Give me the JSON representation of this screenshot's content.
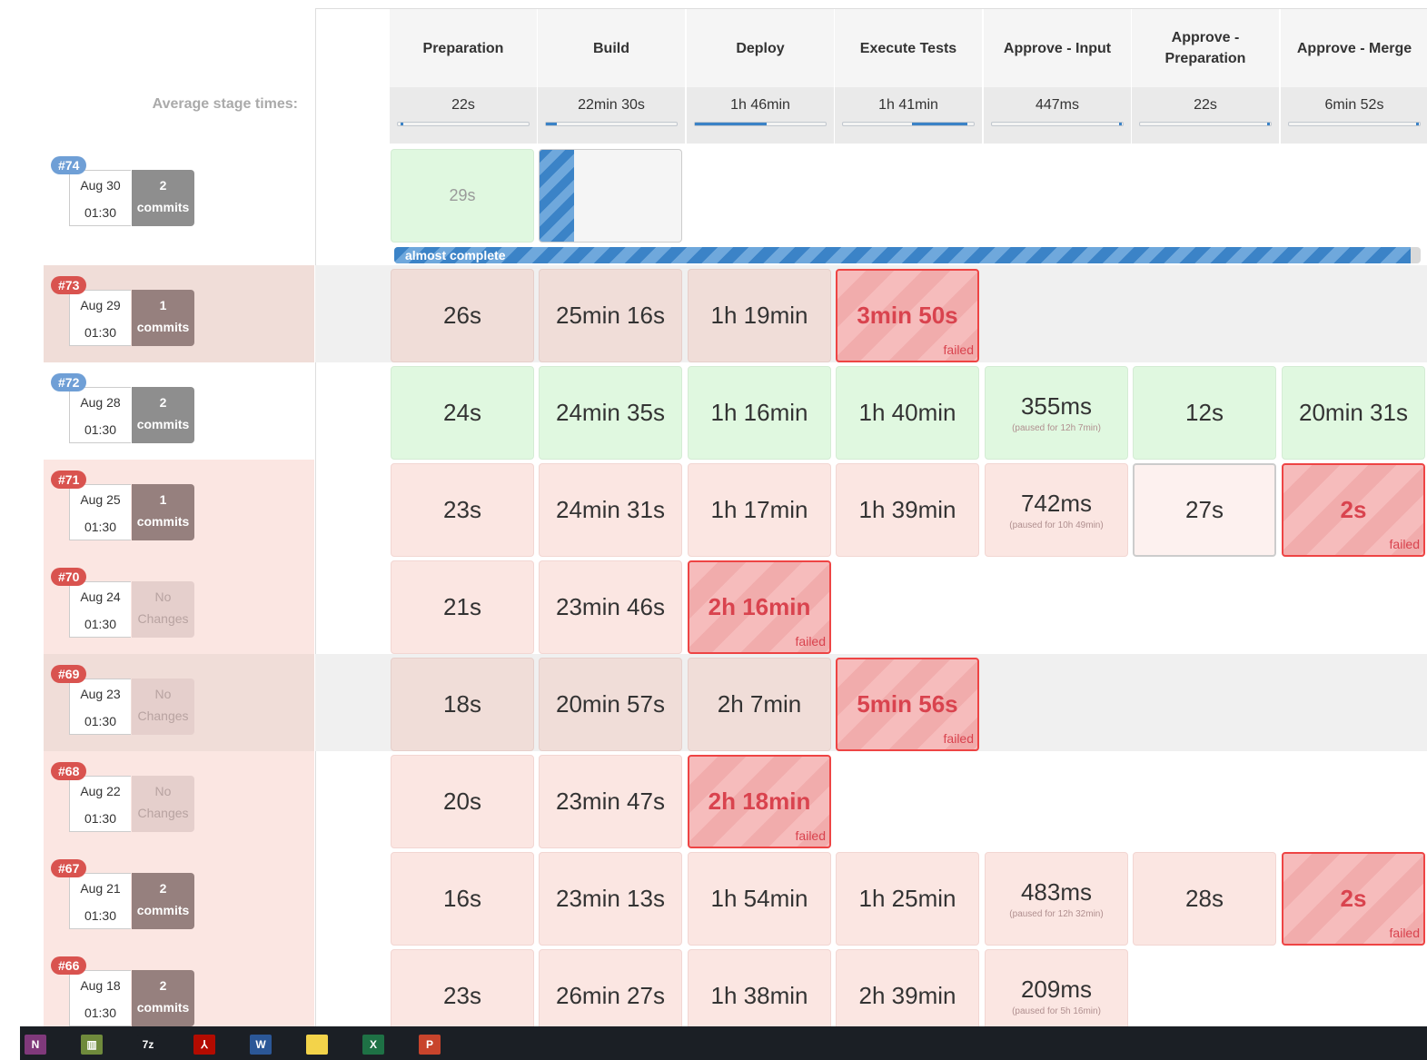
{
  "stages": [
    {
      "name": "Preparation",
      "avg": "22s",
      "fill": [
        0.02,
        0.04
      ]
    },
    {
      "name": "Build",
      "avg": "22min 30s",
      "fill": [
        0.0,
        0.08
      ]
    },
    {
      "name": "Deploy",
      "avg": "1h 46min",
      "fill": [
        0.0,
        0.55
      ]
    },
    {
      "name": "Execute Tests",
      "avg": "1h 41min",
      "fill": [
        0.53,
        0.95
      ]
    },
    {
      "name": "Approve - Input",
      "avg": "447ms",
      "fill": [
        0.97,
        0.99
      ]
    },
    {
      "name": "Approve - Preparation",
      "avg": "22s",
      "fill": [
        0.97,
        0.99
      ]
    },
    {
      "name": "Approve - Merge",
      "avg": "6min 52s",
      "fill": [
        0.97,
        0.99
      ]
    }
  ],
  "avg_label": "Average stage times:",
  "progress_label": "almost complete",
  "progress_fraction": 0.99,
  "builds": [
    {
      "id": "#74",
      "date": "Aug 30",
      "time": "01:30",
      "commits_n": "2",
      "commits_l": "commits",
      "status": "running",
      "cells": [
        {
          "v": "29s",
          "s": "ok"
        },
        {
          "v": "",
          "s": "running"
        },
        null,
        null,
        null,
        null,
        null
      ]
    },
    {
      "id": "#73",
      "date": "Aug 29",
      "time": "01:30",
      "commits_n": "1",
      "commits_l": "commits",
      "status": "failed",
      "cells": [
        {
          "v": "26s",
          "s": "badDark"
        },
        {
          "v": "25min 16s",
          "s": "badDark"
        },
        {
          "v": "1h 19min",
          "s": "badDark"
        },
        {
          "v": "3min 50s",
          "s": "failed"
        },
        null,
        null,
        null
      ]
    },
    {
      "id": "#72",
      "date": "Aug 28",
      "time": "01:30",
      "commits_n": "2",
      "commits_l": "commits",
      "status": "ok",
      "cells": [
        {
          "v": "24s",
          "s": "ok"
        },
        {
          "v": "24min 35s",
          "s": "ok"
        },
        {
          "v": "1h 16min",
          "s": "ok"
        },
        {
          "v": "1h 40min",
          "s": "ok"
        },
        {
          "v": "355ms",
          "s": "ok",
          "p": "(paused for 12h 7min)"
        },
        {
          "v": "12s",
          "s": "ok"
        },
        {
          "v": "20min 31s",
          "s": "ok"
        }
      ]
    },
    {
      "id": "#71",
      "date": "Aug 25",
      "time": "01:30",
      "commits_n": "1",
      "commits_l": "commits",
      "status": "failed",
      "cells": [
        {
          "v": "23s",
          "s": "bad"
        },
        {
          "v": "24min 31s",
          "s": "bad"
        },
        {
          "v": "1h 17min",
          "s": "bad"
        },
        {
          "v": "1h 39min",
          "s": "bad"
        },
        {
          "v": "742ms",
          "s": "bad",
          "p": "(paused for 10h 49min)"
        },
        {
          "v": "27s",
          "s": "unstable"
        },
        {
          "v": "2s",
          "s": "failed"
        }
      ]
    },
    {
      "id": "#70",
      "date": "Aug 24",
      "time": "01:30",
      "commits_n": "No",
      "commits_l": "Changes",
      "status": "failed",
      "nochg": true,
      "cells": [
        {
          "v": "21s",
          "s": "bad"
        },
        {
          "v": "23min 46s",
          "s": "bad"
        },
        {
          "v": "2h 16min",
          "s": "failed"
        },
        null,
        null,
        null,
        null
      ]
    },
    {
      "id": "#69",
      "date": "Aug 23",
      "time": "01:30",
      "commits_n": "No",
      "commits_l": "Changes",
      "status": "failedDark",
      "nochg": true,
      "cells": [
        {
          "v": "18s",
          "s": "badDark"
        },
        {
          "v": "20min 57s",
          "s": "badDark"
        },
        {
          "v": "2h 7min",
          "s": "badDark"
        },
        {
          "v": "5min 56s",
          "s": "failed"
        },
        null,
        null,
        null
      ]
    },
    {
      "id": "#68",
      "date": "Aug 22",
      "time": "01:30",
      "commits_n": "No",
      "commits_l": "Changes",
      "status": "failed",
      "nochg": true,
      "cells": [
        {
          "v": "20s",
          "s": "bad"
        },
        {
          "v": "23min 47s",
          "s": "bad"
        },
        {
          "v": "2h 18min",
          "s": "failed"
        },
        null,
        null,
        null,
        null
      ]
    },
    {
      "id": "#67",
      "date": "Aug 21",
      "time": "01:30",
      "commits_n": "2",
      "commits_l": "commits",
      "status": "failed",
      "cells": [
        {
          "v": "16s",
          "s": "bad"
        },
        {
          "v": "23min 13s",
          "s": "bad"
        },
        {
          "v": "1h 54min",
          "s": "bad"
        },
        {
          "v": "1h 25min",
          "s": "bad"
        },
        {
          "v": "483ms",
          "s": "bad",
          "p": "(paused for 12h 32min)"
        },
        {
          "v": "28s",
          "s": "bad"
        },
        {
          "v": "2s",
          "s": "failed"
        }
      ]
    },
    {
      "id": "#66",
      "date": "Aug 18",
      "time": "01:30",
      "commits_n": "2",
      "commits_l": "commits",
      "status": "failed",
      "cells": [
        {
          "v": "23s",
          "s": "bad"
        },
        {
          "v": "26min 27s",
          "s": "bad"
        },
        {
          "v": "1h 38min",
          "s": "bad"
        },
        {
          "v": "2h 39min",
          "s": "bad"
        },
        {
          "v": "209ms",
          "s": "bad",
          "p": "(paused for 5h 16min)"
        },
        null,
        null
      ]
    }
  ],
  "failed_label": "failed",
  "taskbar": [
    {
      "icon": "onenote-icon",
      "glyph": "N",
      "color": "#80397b"
    },
    {
      "icon": "chart-app-icon",
      "glyph": "▥",
      "color": "#6f8a3c"
    },
    {
      "icon": "7zip-icon",
      "glyph": "7z",
      "color": "#1b1f25"
    },
    {
      "icon": "acrobat-icon",
      "glyph": "⅄",
      "color": "#b30b00"
    },
    {
      "icon": "word-icon",
      "glyph": "W",
      "color": "#2b5797"
    },
    {
      "icon": "sticky-notes-icon",
      "glyph": "",
      "color": "#f3d34a"
    },
    {
      "icon": "excel-icon",
      "glyph": "X",
      "color": "#1e7145"
    },
    {
      "icon": "powerpoint-icon",
      "glyph": "P",
      "color": "#c8442c"
    }
  ]
}
